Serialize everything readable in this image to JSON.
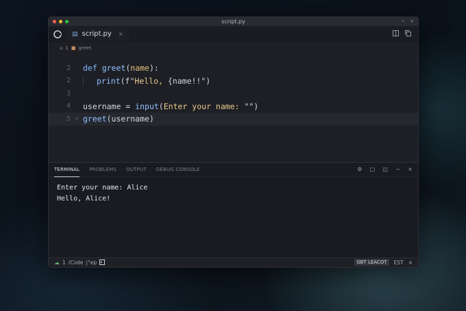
{
  "window": {
    "title": "script.py",
    "controls": [
      "−",
      "×"
    ]
  },
  "tabbar": {
    "tab": {
      "label": "script.py",
      "close": "×"
    }
  },
  "breadcrumb": {
    "items": [
      "1",
      "greet"
    ]
  },
  "editor": {
    "lines": [
      {
        "num": "2",
        "tokens": [
          [
            "kw",
            "def "
          ],
          [
            "fn",
            "greet"
          ],
          [
            "p",
            "("
          ],
          [
            "param",
            "name"
          ],
          [
            "p",
            "):"
          ]
        ]
      },
      {
        "num": "2",
        "indent": true,
        "tokens": [
          [
            "fn",
            "print"
          ],
          [
            "p",
            "(f\""
          ],
          [
            "str",
            "Hello, "
          ],
          [
            "p",
            "{name!!\")"
          ]
        ]
      },
      {
        "num": "3",
        "tokens": []
      },
      {
        "num": "4",
        "tokens": [
          [
            "p",
            "username = "
          ],
          [
            "fn",
            "input"
          ],
          [
            "p",
            "("
          ],
          [
            "str",
            "Enter your name: "
          ],
          [
            "p",
            "\"\")"
          ]
        ]
      },
      {
        "num": "5",
        "tokens": [
          [
            "fn",
            "greet"
          ],
          [
            "p",
            "(username)"
          ]
        ]
      }
    ]
  },
  "panel": {
    "tabs": [
      "TERMINAL",
      "PROBLEMS",
      "OUTPUT",
      "DEBUG CONSOLE"
    ],
    "active": 0,
    "terminal_lines": [
      "Enter your name: Alice",
      "Hello, Alice!"
    ]
  },
  "statusbar": {
    "left": [
      "1",
      "/Code",
      "|°ep"
    ],
    "right_badge": "GBT  LEACOT",
    "right_items": [
      "EST",
      "×"
    ]
  }
}
